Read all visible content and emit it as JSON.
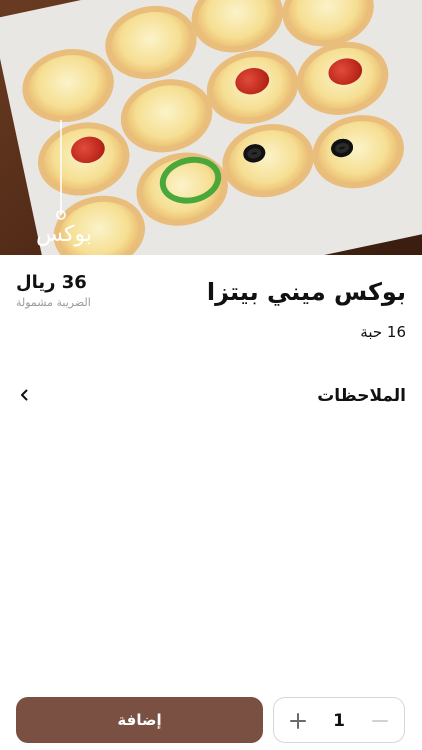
{
  "hero": {
    "image": "mini-pizza-box-photo",
    "brand_label": "بوكس"
  },
  "product": {
    "title": "بوكس ميني بيتزا",
    "quantity_text": "16 حبة",
    "price": "36 ريال",
    "tax_note": "الضريبة مشمولة"
  },
  "notes": {
    "label": "الملاحظات",
    "icon": "chevron-left-icon"
  },
  "cart": {
    "quantity": "1",
    "minus_icon": "minus-icon",
    "plus_icon": "plus-icon",
    "add_label": "إضافة"
  },
  "colors": {
    "primary": "#7a5043",
    "stepper_border": "#d7d7d7",
    "muted_text": "#9a9a9a"
  }
}
